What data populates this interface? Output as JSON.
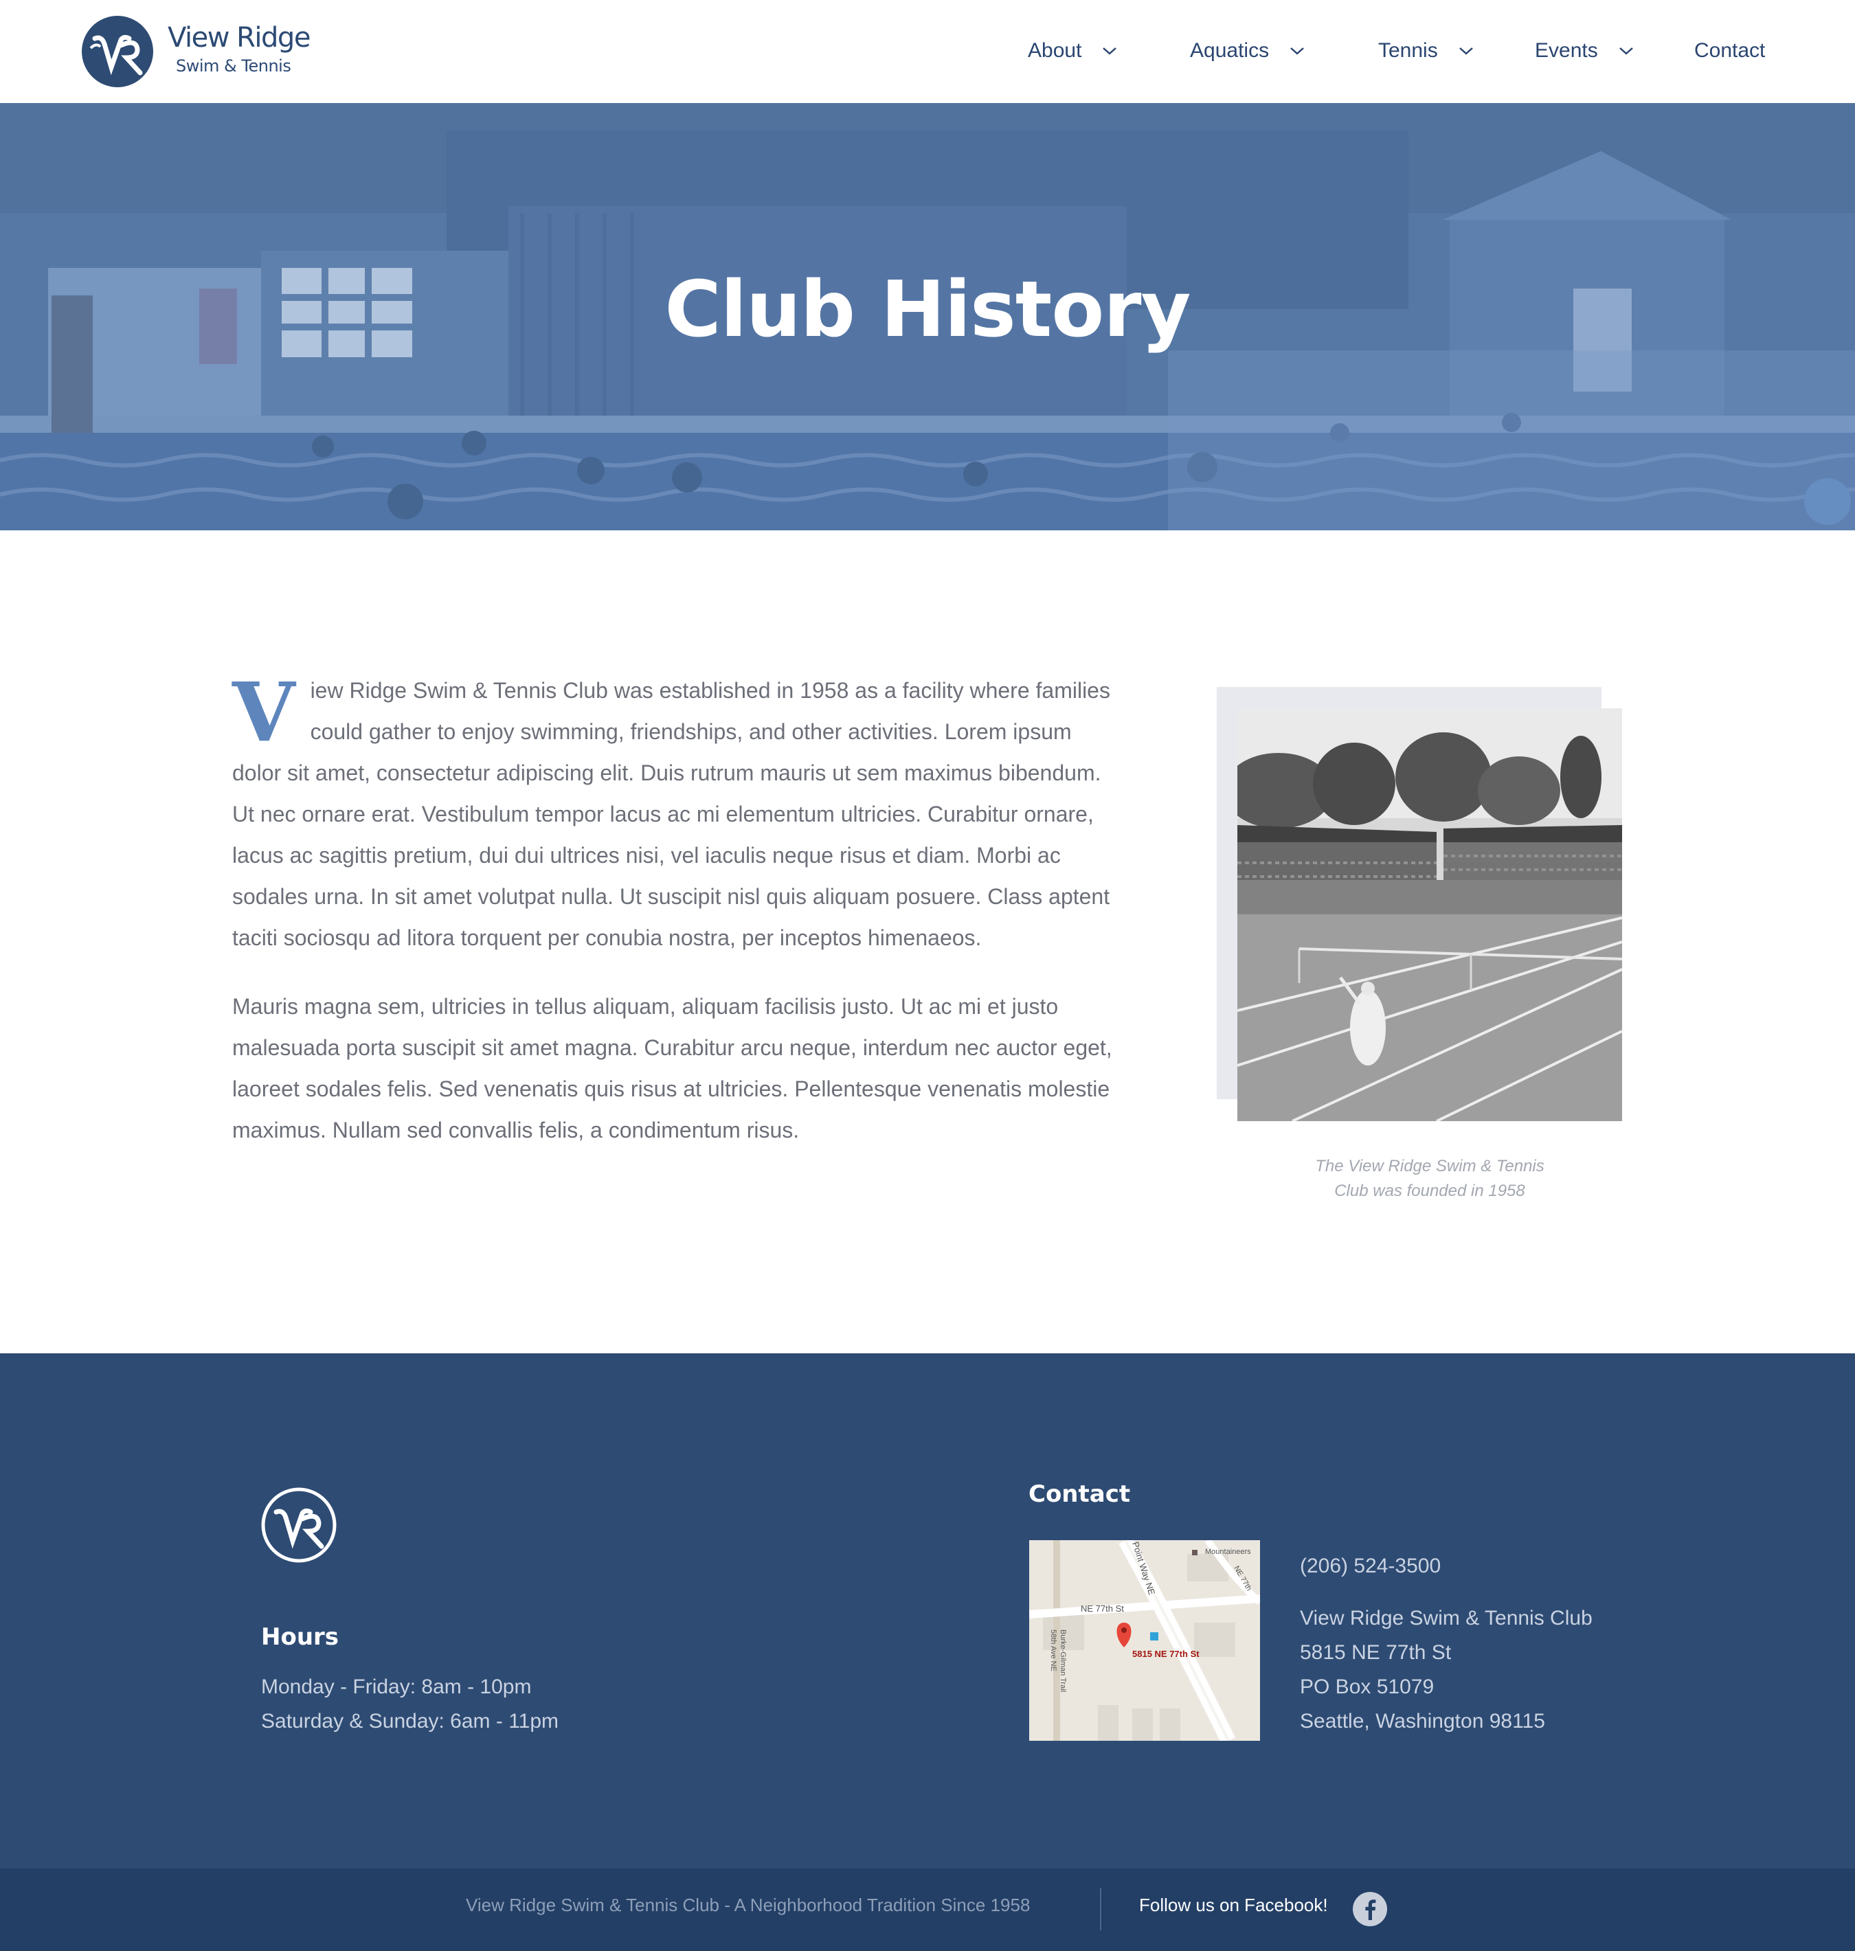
{
  "brand": {
    "name": "View Ridge",
    "tagline": "Swim & Tennis"
  },
  "nav": {
    "items": [
      {
        "label": "About",
        "has_dropdown": true
      },
      {
        "label": "Aquatics",
        "has_dropdown": true
      },
      {
        "label": "Tennis",
        "has_dropdown": true
      },
      {
        "label": "Events",
        "has_dropdown": true
      },
      {
        "label": "Contact",
        "has_dropdown": false
      }
    ]
  },
  "hero": {
    "title": "Club History"
  },
  "article": {
    "dropcap": "V",
    "p1_rest": "iew Ridge Swim & Tennis Club was established in 1958 as a facility where families could gather to enjoy swimming, friendships, and other activities. Lorem ipsum dolor sit amet, consectetur adipiscing elit. Duis rutrum mauris ut sem maximus bibendum. Ut nec ornare erat. Vestibulum tempor lacus ac mi elementum ultricies. Curabitur ornare, lacus ac sagittis pretium, dui dui ultrices nisi, vel iaculis neque risus et diam. Morbi ac sodales urna. In sit amet volutpat nulla. Ut suscipit nisl quis aliquam posuere. Class aptent taciti sociosqu ad litora torquent per conubia nostra, per inceptos himenaeos.",
    "p2": "Mauris magna sem, ultricies in tellus aliquam, aliquam facilisis justo. Ut ac mi et justo malesuada porta suscipit sit amet magna. Curabitur arcu neque, interdum nec auctor eget, laoreet sodales felis. Sed venenatis quis risus at ultricies. Pellentesque venenatis molestie maximus. Nullam sed convallis felis, a condimentum risus."
  },
  "figure": {
    "caption_line1": "The View Ridge Swim & Tennis",
    "caption_line2": "Club was founded in 1958"
  },
  "footer": {
    "hours": {
      "heading": "Hours",
      "weekday": "Monday - Friday: 8am - 10pm",
      "weekend": "Saturday & Sunday: 6am - 11pm"
    },
    "contact": {
      "heading": "Contact",
      "phone": "(206) 524-3500",
      "org": "View Ridge Swim & Tennis Club",
      "street": "5815 NE 77th St",
      "po_box": "PO Box 51079",
      "city": "Seattle, Washington 98115"
    },
    "map": {
      "pin_label": "5815 NE 77th St",
      "street_ne77": "NE 77th St",
      "street_point_way": "Point Way NE",
      "street_58th": "58th Ave NE",
      "trail": "Burke-Gilman Trail",
      "poi": "Mountaineers",
      "street_ne77_upper": "NE 77th"
    },
    "bottom": {
      "tagline": "View Ridge Swim & Tennis Club - A Neighborhood Tradition Since 1958",
      "follow": "Follow us on Facebook!"
    }
  },
  "colors": {
    "navy": "#2e4b73",
    "navy_dark": "#233f66",
    "accent_blue": "#5e86bd",
    "hero_overlay": "#5678a3",
    "body_text": "#6c6f78"
  },
  "icons": [
    "chevron-down-icon",
    "facebook-icon",
    "map-pin-icon",
    "vr-logo-icon"
  ]
}
